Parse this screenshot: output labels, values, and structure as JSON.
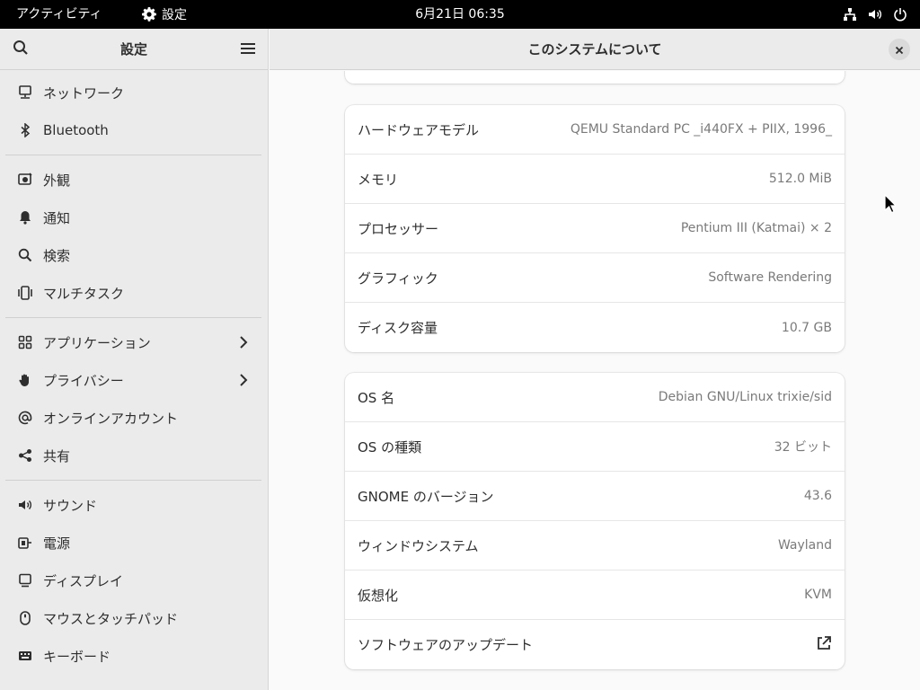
{
  "topbar": {
    "activities": "アクティビティ",
    "app_name": "設定",
    "clock": "6月21日  06:35"
  },
  "sidebar": {
    "title": "設定",
    "groups": [
      [
        {
          "label": "ネットワーク",
          "icon": "network-icon"
        },
        {
          "label": "Bluetooth",
          "icon": "bluetooth-icon"
        }
      ],
      [
        {
          "label": "外観",
          "icon": "appearance-icon"
        },
        {
          "label": "通知",
          "icon": "bell-icon"
        },
        {
          "label": "検索",
          "icon": "search-icon"
        },
        {
          "label": "マルチタスク",
          "icon": "multitasking-icon"
        }
      ],
      [
        {
          "label": "アプリケーション",
          "icon": "apps-grid-icon",
          "chevron": true
        },
        {
          "label": "プライバシー",
          "icon": "hand-icon",
          "chevron": true
        },
        {
          "label": "オンラインアカウント",
          "icon": "at-icon"
        },
        {
          "label": "共有",
          "icon": "share-icon"
        }
      ],
      [
        {
          "label": "サウンド",
          "icon": "speaker-icon"
        },
        {
          "label": "電源",
          "icon": "power-plug-icon"
        },
        {
          "label": "ディスプレイ",
          "icon": "display-icon"
        },
        {
          "label": "マウスとタッチパッド",
          "icon": "mouse-icon"
        },
        {
          "label": "キーボード",
          "icon": "keyboard-icon"
        }
      ]
    ]
  },
  "main": {
    "title": "このシステムについて",
    "hardware": [
      {
        "label": "ハードウェアモデル",
        "value": "QEMU Standard PC _i440FX + PIIX, 1996_"
      },
      {
        "label": "メモリ",
        "value": "512.0 MiB"
      },
      {
        "label": "プロセッサー",
        "value": "Pentium III (Katmai) × 2"
      },
      {
        "label": "グラフィック",
        "value": "Software Rendering"
      },
      {
        "label": "ディスク容量",
        "value": "10.7 GB"
      }
    ],
    "software": [
      {
        "label": "OS 名",
        "value": "Debian GNU/Linux trixie/sid"
      },
      {
        "label": "OS の種類",
        "value": "32 ビット"
      },
      {
        "label": "GNOME のバージョン",
        "value": "43.6"
      },
      {
        "label": "ウィンドウシステム",
        "value": "Wayland"
      },
      {
        "label": "仮想化",
        "value": "KVM"
      },
      {
        "label": "ソフトウェアのアップデート",
        "value": "",
        "icon": "external-link-icon"
      }
    ]
  }
}
